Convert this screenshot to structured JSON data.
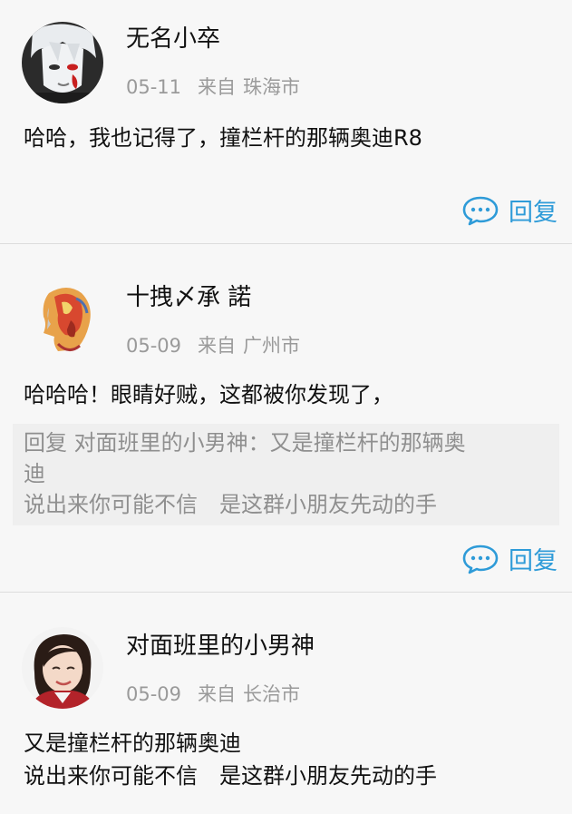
{
  "comments": [
    {
      "username": "无名小卒",
      "date": "05-11",
      "location_label": "来自",
      "location": "珠海市",
      "text": "哈哈，我也记得了，撞栏杆的那辆奥迪R8",
      "reply_label": "回复",
      "avatar_icon": "anime-avatar-icon"
    },
    {
      "username": "十拽〆承 諾",
      "date": "05-09",
      "location_label": "来自",
      "location": "广州市",
      "text": "哈哈哈！眼睛好贼，这都被你发现了，",
      "quote": {
        "prefix": "回复",
        "quoted_user": "对面班里的小男神：",
        "line1": "又是撞栏杆的那辆奥",
        "line2": "迪",
        "line3a": "说出来你可能不信",
        "line3b": "是这群小朋友先动的手"
      },
      "reply_label": "回复",
      "avatar_icon": "painted-face-avatar-icon"
    },
    {
      "username": "对面班里的小男神",
      "date": "05-09",
      "location_label": "来自",
      "location": "长治市",
      "text_line1": "又是撞栏杆的那辆奥迪",
      "text_line2a": "说出来你可能不信",
      "text_line2b": "是这群小朋友先动的手",
      "avatar_icon": "girl-photo-avatar-icon"
    }
  ],
  "colors": {
    "accent": "#2e9bd8",
    "meta": "#9a9a9a",
    "quote_bg": "#efefef",
    "divider": "#dcdcdc"
  }
}
